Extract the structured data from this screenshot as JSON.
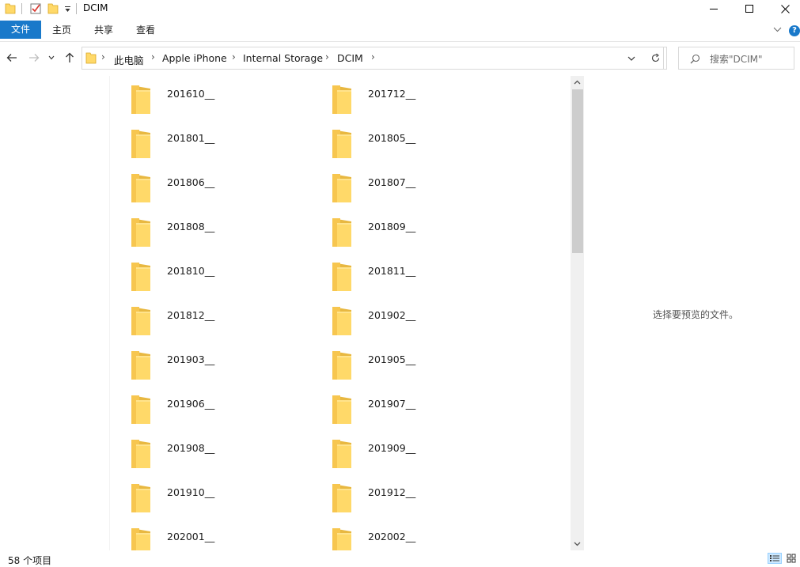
{
  "window": {
    "title": "DCIM"
  },
  "ribbon": {
    "tabs": [
      {
        "label": "文件"
      },
      {
        "label": "主页"
      },
      {
        "label": "共享"
      },
      {
        "label": "查看"
      }
    ]
  },
  "address": {
    "crumbs": [
      {
        "label": "此电脑"
      },
      {
        "label": "Apple iPhone"
      },
      {
        "label": "Internal Storage"
      },
      {
        "label": "DCIM"
      }
    ]
  },
  "search": {
    "placeholder": "搜索\"DCIM\""
  },
  "folders": [
    {
      "name": "201610__"
    },
    {
      "name": "201712__"
    },
    {
      "name": "201801__"
    },
    {
      "name": "201805__"
    },
    {
      "name": "201806__"
    },
    {
      "name": "201807__"
    },
    {
      "name": "201808__"
    },
    {
      "name": "201809__"
    },
    {
      "name": "201810__"
    },
    {
      "name": "201811__"
    },
    {
      "name": "201812__"
    },
    {
      "name": "201902__"
    },
    {
      "name": "201903__"
    },
    {
      "name": "201905__"
    },
    {
      "name": "201906__"
    },
    {
      "name": "201907__"
    },
    {
      "name": "201908__"
    },
    {
      "name": "201909__"
    },
    {
      "name": "201910__"
    },
    {
      "name": "201912__"
    },
    {
      "name": "202001__"
    },
    {
      "name": "202002__"
    }
  ],
  "preview": {
    "message": "选择要预览的文件。"
  },
  "status": {
    "item_count": "58 个项目"
  },
  "colors": {
    "accent": "#1979ca",
    "folder_front": "#ffd969",
    "folder_back": "#e8b841"
  }
}
